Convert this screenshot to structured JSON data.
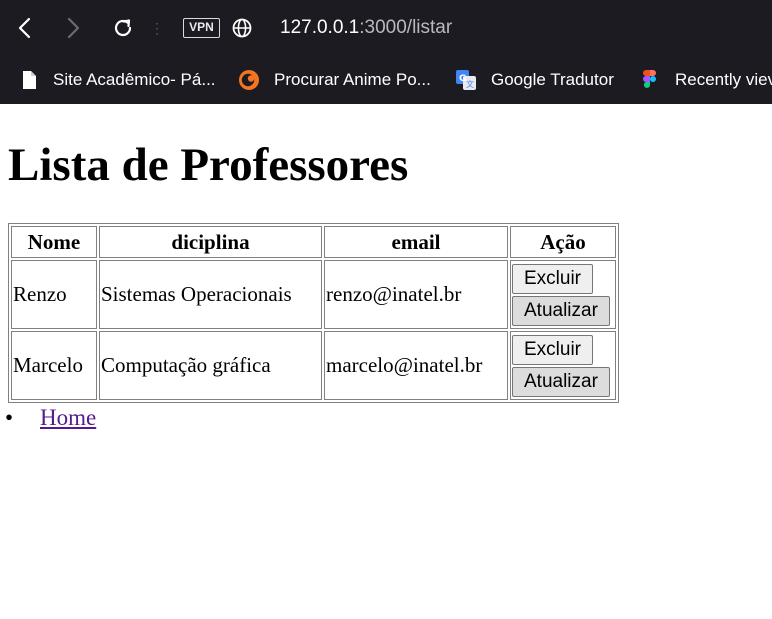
{
  "browser": {
    "url_host": "127.0.0.1",
    "url_rest": ":3000/listar",
    "vpn_label": "VPN",
    "icons": {
      "back": "back-arrow-icon",
      "forward": "forward-arrow-icon",
      "reload": "reload-icon",
      "globe": "globe-icon"
    },
    "bookmarks": [
      {
        "label": "Site Acadêmico- Pá...",
        "icon": "page-icon"
      },
      {
        "label": "Procurar Anime Po...",
        "icon": "crunchyroll-icon"
      },
      {
        "label": "Google Tradutor",
        "icon": "google-translate-icon"
      },
      {
        "label": "Recently viev",
        "icon": "figma-icon"
      }
    ]
  },
  "page": {
    "title": "Lista de Professores",
    "table": {
      "headers": [
        "Nome",
        "diciplina",
        "email",
        "Ação"
      ],
      "rows": [
        {
          "nome": "Renzo",
          "disciplina": "Sistemas Operacionais",
          "email": "renzo@inatel.br"
        },
        {
          "nome": "Marcelo",
          "disciplina": "Computação gráfica",
          "email": "marcelo@inatel.br"
        }
      ],
      "delete_label": "Excluir",
      "update_label": "Atualizar"
    },
    "nav_links": [
      {
        "label": "Home"
      }
    ]
  },
  "colors": {
    "chrome_bg": "#1c1b22",
    "visited_link": "#551a8b"
  }
}
